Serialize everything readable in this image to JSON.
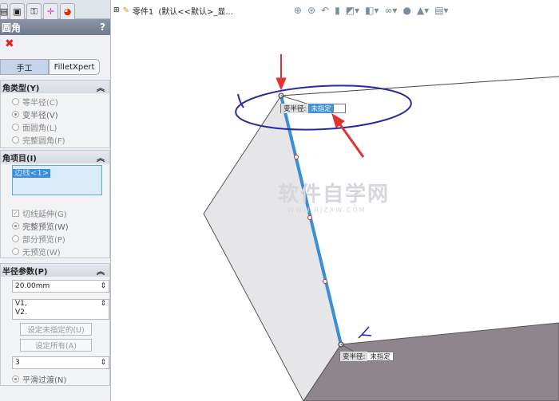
{
  "panel": {
    "title": "圆角",
    "help": "?",
    "ok_icon": "check-icon",
    "cancel_icon": "close-icon",
    "modes": [
      "手工",
      "FilletXpert"
    ],
    "type_section": {
      "title": "角类型(Y)",
      "options": [
        "等半径(C)",
        "变半径(V)",
        "面圆角(L)",
        "完整圆角(F)"
      ],
      "selected": 1
    },
    "items_section": {
      "title": "角项目(I)",
      "list": [
        "边线<1>"
      ],
      "tangent": "切线延伸(G)",
      "previews": [
        "完整预览(W)",
        "部分预览(P)",
        "无预览(W)"
      ],
      "preview_selected": 0
    },
    "radius_section": {
      "title": "半径参数(P)",
      "radius": "20.00mm",
      "vertices": [
        "V1,",
        "V2."
      ],
      "set_unassigned": "设定未指定的(U)",
      "set_all": "设定所有(A)",
      "instances": "3",
      "smooth": "平滑过渡(N)"
    }
  },
  "toolbar": {
    "tree_label": "零件1",
    "config": "(默认<<默认>_显..."
  },
  "view": {
    "callout_label": "变半径:",
    "callout_value": "未指定",
    "watermark": "软件自学网",
    "watermark_url": "WWW.RJZXW.COM",
    "colors": {
      "edge": "#3b8fd6",
      "annotation": "#2a2aa0",
      "arrow": "#e53030"
    }
  }
}
